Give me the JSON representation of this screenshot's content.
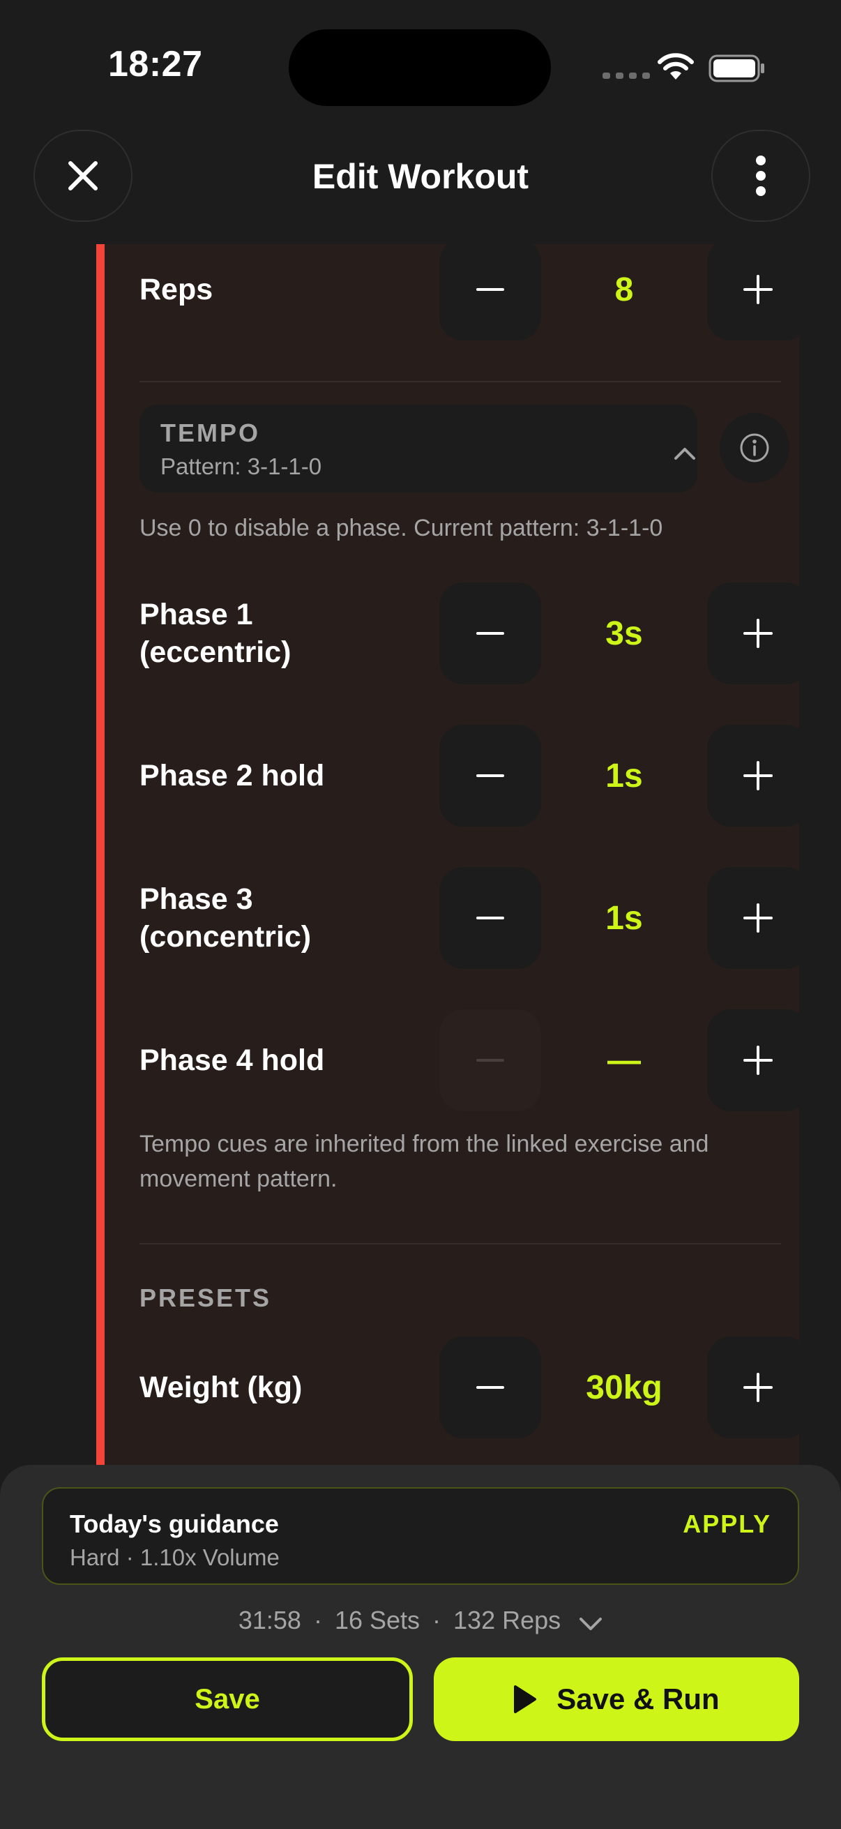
{
  "status_bar": {
    "time": "18:27"
  },
  "header": {
    "title": "Edit Workout"
  },
  "reps": {
    "label": "Reps",
    "value": "8"
  },
  "tempo": {
    "title": "TEMPO",
    "pattern": "Pattern: 3-1-1-0",
    "hint": "Use 0 to disable a phase. Current pattern: 3-1-1-0",
    "phases": [
      {
        "label": "Phase 1 (eccentric)",
        "value": "3s"
      },
      {
        "label": "Phase 2 hold",
        "value": "1s"
      },
      {
        "label": "Phase 3 (concentric)",
        "value": "1s"
      },
      {
        "label": "Phase 4 hold",
        "value": "—"
      }
    ],
    "note": "Tempo cues are inherited from the linked exercise and movement pattern."
  },
  "presets": {
    "title": "PRESETS",
    "weight": {
      "label": "Weight (kg)",
      "value": "30kg"
    }
  },
  "guidance": {
    "title": "Today's guidance",
    "subtitle": "Hard · 1.10x Volume",
    "apply_label": "APPLY"
  },
  "summary": {
    "duration": "31:58",
    "sets": "16 Sets",
    "reps": "132 Reps",
    "separator": "·"
  },
  "actions": {
    "save_label": "Save",
    "save_run_label": "Save & Run"
  },
  "colors": {
    "accent": "#cdf518",
    "stripe": "#f2453a",
    "card": "#271d1b",
    "background": "#1c1c1c"
  },
  "icons": [
    "close-icon",
    "more-vertical-icon",
    "minus-icon",
    "plus-icon",
    "chevron-up-icon",
    "info-icon",
    "chevron-down-icon",
    "play-icon",
    "wifi-icon",
    "battery-icon"
  ]
}
